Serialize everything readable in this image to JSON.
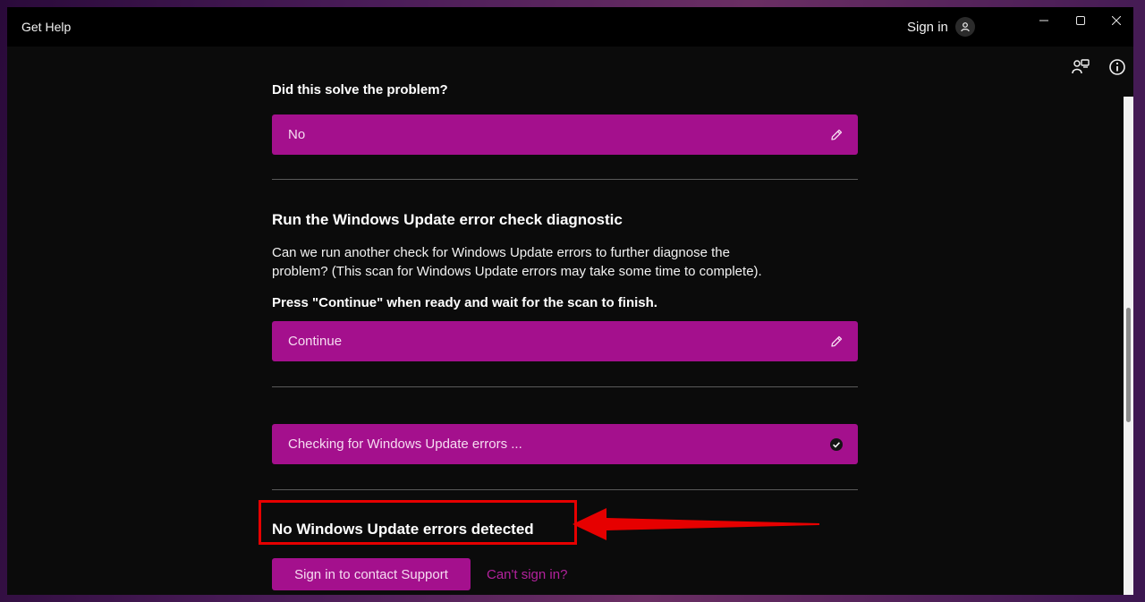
{
  "window": {
    "title": "Get Help",
    "sign_in_label": "Sign in"
  },
  "icons": {
    "avatar": "person-icon",
    "minimize": "minimize-icon",
    "maximize": "maximize-icon",
    "close": "close-icon",
    "community": "community-icon",
    "info": "info-icon",
    "edit": "pencil-icon",
    "done": "checkmark-circle-icon"
  },
  "conversation": {
    "question1": "Did this solve the problem?",
    "answer1": "No",
    "diagnostic_heading": "Run the Windows Update error check diagnostic",
    "diagnostic_text": "Can we run another check for Windows Update errors to further diagnose the problem? (This scan for Windows Update errors may take some time to complete).",
    "diagnostic_instruction": "Press \"Continue\" when ready and wait for the scan to finish.",
    "answer2": "Continue",
    "status": "Checking for Windows Update errors ...",
    "result_heading": "No Windows Update errors detected",
    "support_button": "Sign in to contact Support",
    "cant_sign_in": "Can't sign in?"
  },
  "colors": {
    "accent": "#a4108d",
    "link": "#b3229d",
    "annotation": "#e60000",
    "background": "#0b0b0b"
  }
}
